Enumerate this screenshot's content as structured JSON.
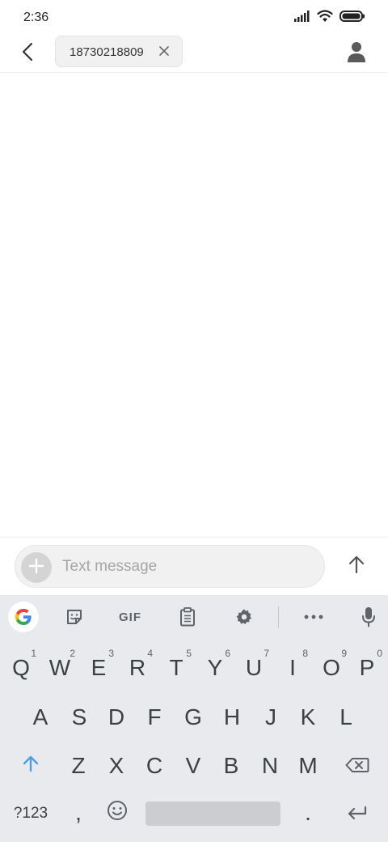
{
  "status_bar": {
    "time": "2:36",
    "icons": [
      "signal-icon",
      "wifi-icon",
      "battery-icon"
    ]
  },
  "header": {
    "back_icon": "back-arrow-icon",
    "recipient": "18730218809",
    "chip_close_icon": "close-icon",
    "contact_icon": "person-icon"
  },
  "composer": {
    "placeholder": "Text message",
    "value": "",
    "attach_icon": "plus-icon",
    "send_icon": "arrow-up-icon"
  },
  "keyboard": {
    "toolbar": {
      "items": [
        "google-icon",
        "sticker-icon",
        "gif",
        "clipboard-icon",
        "settings-gear-icon",
        "more-icon",
        "microphone-icon"
      ],
      "gif_label": "GIF"
    },
    "row1": [
      {
        "label": "Q",
        "hint": "1"
      },
      {
        "label": "W",
        "hint": "2"
      },
      {
        "label": "E",
        "hint": "3"
      },
      {
        "label": "R",
        "hint": "4"
      },
      {
        "label": "T",
        "hint": "5"
      },
      {
        "label": "Y",
        "hint": "6"
      },
      {
        "label": "U",
        "hint": "7"
      },
      {
        "label": "I",
        "hint": "8"
      },
      {
        "label": "O",
        "hint": "9"
      },
      {
        "label": "P",
        "hint": "0"
      }
    ],
    "row2": [
      "A",
      "S",
      "D",
      "F",
      "G",
      "H",
      "J",
      "K",
      "L"
    ],
    "row3": [
      "Z",
      "X",
      "C",
      "V",
      "B",
      "N",
      "M"
    ],
    "row4": {
      "symbols_label": "?123",
      "comma_label": ",",
      "period_label": "."
    },
    "accent_color": "#4a9ee6"
  }
}
